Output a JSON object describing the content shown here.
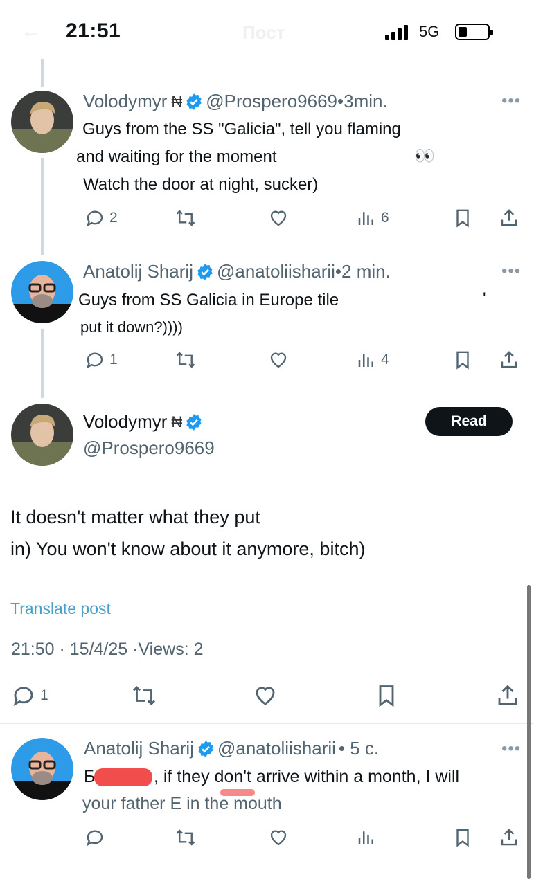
{
  "status_bar": {
    "time": "21:51",
    "network": "5G",
    "ghost_title": "Пост"
  },
  "tweets": [
    {
      "name": "Volodymyr",
      "handle": "@Prospero9669",
      "time": "•3min.",
      "lines": [
        "Guys from the SS \"Galicia\", tell you flaming",
        "and waiting for the moment",
        "Watch the door at night, sucker)"
      ],
      "emoji": "👀",
      "replies": "2",
      "views": "6"
    },
    {
      "name": "Anatolij Sharij",
      "handle": "@anatoliisharii",
      "time": "•2 min.",
      "lines": [
        "Guys from SS Galicia in Europe tile",
        "put it down?))))"
      ],
      "tick": "'",
      "replies": "1",
      "views": "4"
    }
  ],
  "main_post": {
    "name": "Volodymyr",
    "handle": "@Prospero9669",
    "read_label": "Read",
    "lines": [
      "It doesn't matter what they put",
      "in) You won't know about it anymore, bitch)"
    ],
    "translate_label": "Translate post",
    "meta": "21:50 · 15/4/25 ·Views: 2",
    "replies": "1"
  },
  "reply": {
    "name": "Anatolij Sharij",
    "handle": "@anatoliisharii",
    "time": "• 5 с.",
    "lines": [
      "Б",
      ", if they don't arrive within a month, I will",
      "your father E in the mouth"
    ]
  },
  "colors": {
    "accent": "#1d9bf0",
    "muted": "#536471",
    "link": "#4aa0c9"
  }
}
